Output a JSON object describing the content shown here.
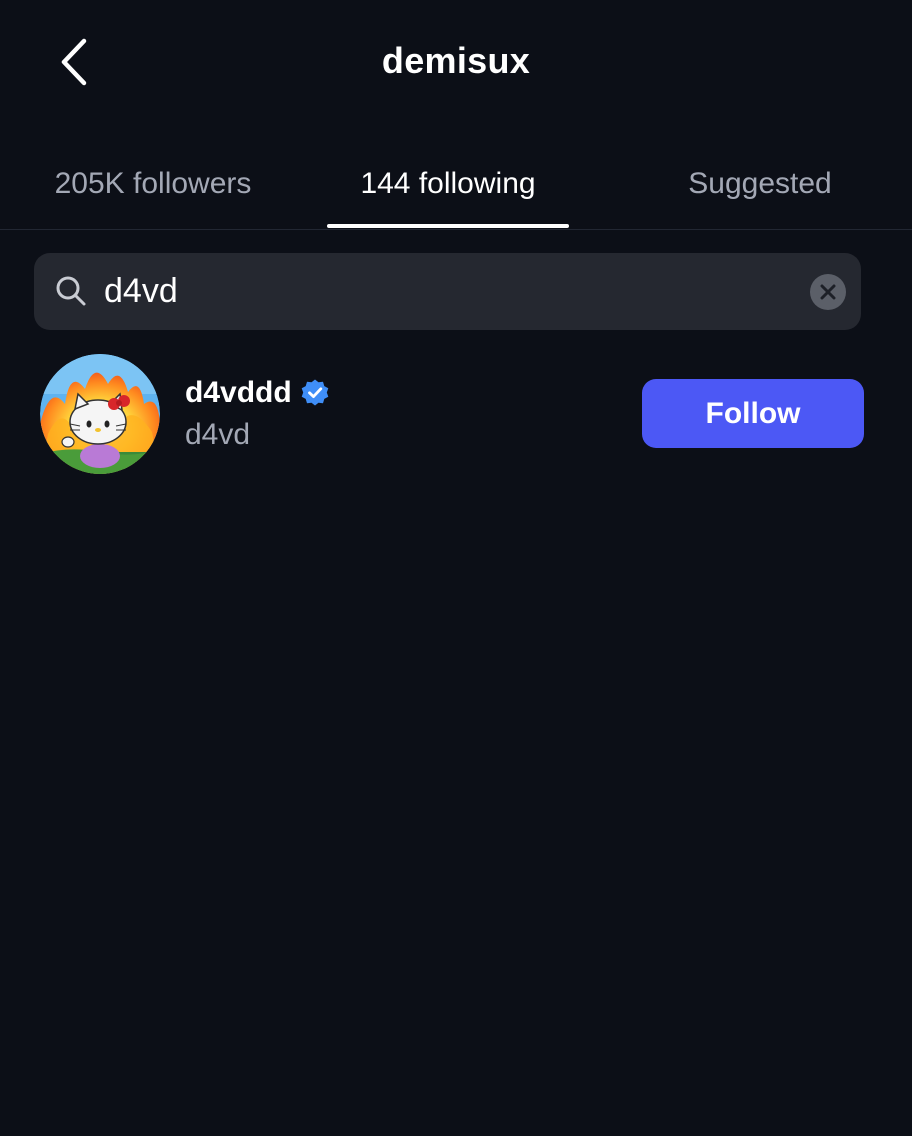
{
  "header": {
    "title": "demisux",
    "back_icon": "chevron-left-icon"
  },
  "tabs": [
    {
      "label": "205K followers",
      "active": false
    },
    {
      "label": "144 following",
      "active": true
    },
    {
      "label": "Suggested",
      "active": false
    }
  ],
  "search": {
    "value": "d4vd",
    "icon": "search-icon",
    "clear_icon": "clear-icon"
  },
  "results": [
    {
      "username": "d4vddd",
      "display_name": "d4vd",
      "verified": true,
      "button_label": "Follow",
      "avatar_icon": "hello-kitty-avatar"
    }
  ],
  "colors": {
    "background": "#0c0f17",
    "search_bg": "#252830",
    "follow_button": "#4c58f5",
    "verified": "#3f8ef7",
    "muted_text": "#a3a8b5"
  }
}
